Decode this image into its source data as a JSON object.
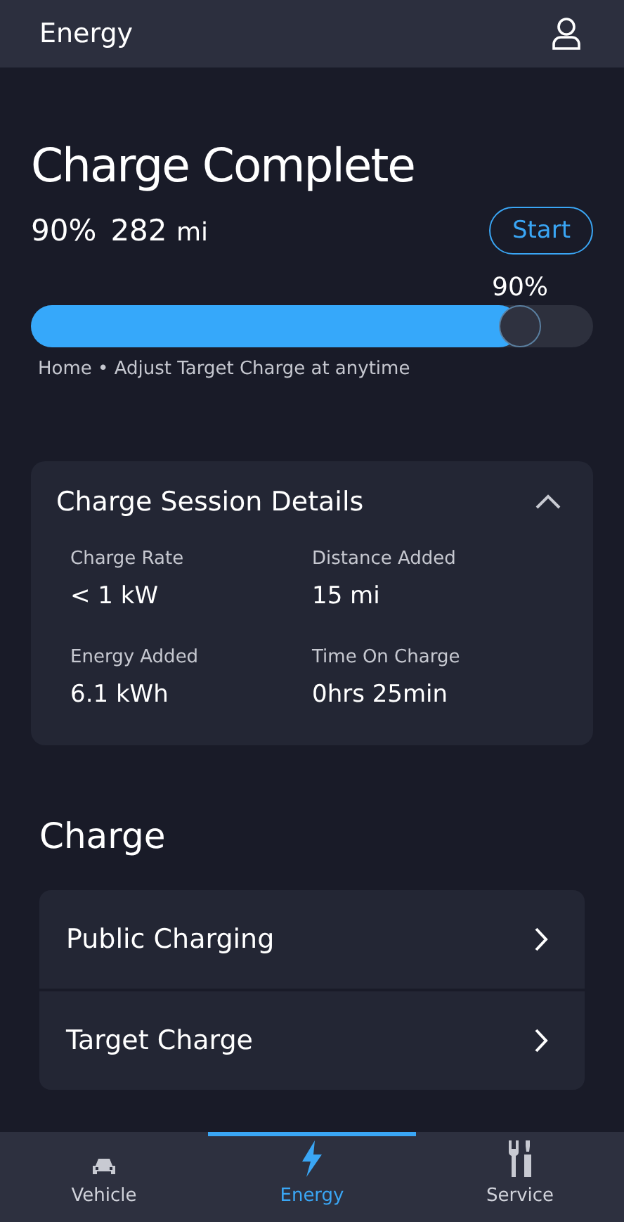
{
  "header": {
    "title": "Energy"
  },
  "status": {
    "title": "Charge Complete",
    "percent": "90%",
    "range": "282",
    "range_unit": "mi",
    "button": "Start"
  },
  "target": {
    "label": "90%",
    "level": 0.87,
    "note": "Home • Adjust Target Charge at anytime"
  },
  "session": {
    "title": "Charge Session Details",
    "expanded": true,
    "details": [
      {
        "label": "Charge Rate",
        "value": "< 1 kW"
      },
      {
        "label": "Distance Added",
        "value": "15 mi"
      },
      {
        "label": "Energy Added",
        "value": "6.1 kWh"
      },
      {
        "label": "Time On Charge",
        "value": "0hrs 25min"
      }
    ]
  },
  "charge": {
    "title": "Charge",
    "items": [
      "Public Charging",
      "Target Charge"
    ]
  },
  "tabs": [
    {
      "label": "Vehicle",
      "selected": false
    },
    {
      "label": "Energy",
      "selected": true
    },
    {
      "label": "Service",
      "selected": false
    }
  ]
}
